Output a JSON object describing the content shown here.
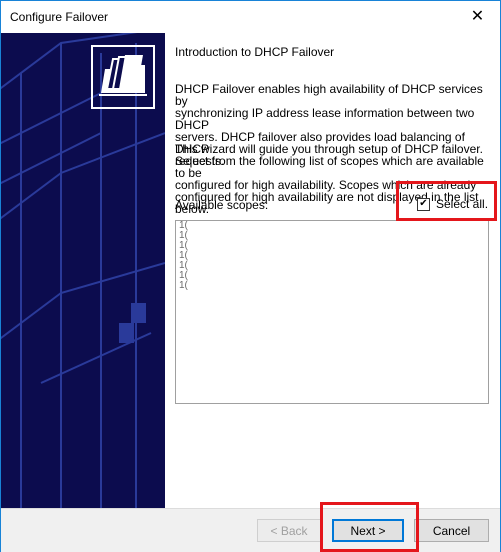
{
  "window": {
    "title": "Configure Failover",
    "close_glyph": "✕"
  },
  "sidebar": {
    "icon": "folder-documents-icon"
  },
  "content": {
    "heading": "Introduction to DHCP Failover",
    "paragraph1_lines": [
      "DHCP Failover enables high availability of DHCP services by",
      "synchronizing IP address lease information between two DHCP",
      "servers. DHCP failover also provides load balancing of DHCP",
      "requests."
    ],
    "paragraph2_lines": [
      "This wizard will guide you through setup of DHCP failover.",
      "Select from the following list of scopes which are available to be",
      "configured for high availability. Scopes which are already",
      "configured for high availability are not displayed in the list below."
    ],
    "available_scopes_label": "Available scopes:",
    "select_all_label": "Select all.",
    "select_all_checked": true,
    "checkbox_glyph": "✔",
    "scopes": [
      "1(",
      "1(",
      "1(",
      "1(",
      "1(",
      "1(",
      "1("
    ]
  },
  "buttons": {
    "back": "< Back",
    "next": "Next >",
    "cancel": "Cancel"
  },
  "colors": {
    "sidebar": "#0c0c4e",
    "highlight": "#e4161b",
    "accent": "#0078d7"
  }
}
